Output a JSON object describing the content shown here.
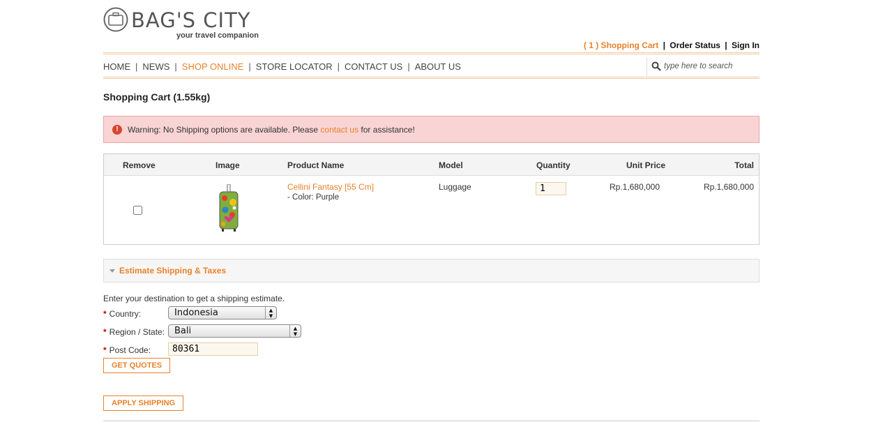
{
  "brand": {
    "name": "BAG'S CITY",
    "tagline": "your travel companion"
  },
  "toplinks": {
    "cart": "( 1 ) Shopping Cart",
    "sep1": "|",
    "order_status": "Order Status",
    "sep2": "|",
    "sign_in": "Sign In"
  },
  "nav": {
    "items": [
      {
        "label": "HOME"
      },
      {
        "label": "NEWS"
      },
      {
        "label": "SHOP ONLINE"
      },
      {
        "label": "STORE LOCATOR"
      },
      {
        "label": "CONTACT US"
      },
      {
        "label": "ABOUT US"
      }
    ],
    "separator": "|",
    "active_index": 2
  },
  "search": {
    "placeholder": "type here to search"
  },
  "page": {
    "title": "Shopping Cart  (1.55kg)"
  },
  "warning": {
    "icon": "!",
    "text_before": "Warning: No Shipping options are available. Please ",
    "link": "contact us",
    "text_after": " for assistance!"
  },
  "cart": {
    "headers": {
      "remove": "Remove",
      "image": "Image",
      "product_name": "Product Name",
      "model": "Model",
      "quantity": "Quantity",
      "unit_price": "Unit Price",
      "total": "Total"
    },
    "rows": [
      {
        "product_name": "Cellini Fantasy [55 Cm]",
        "option": "- Color: Purple",
        "model": "Luggage",
        "quantity": "1",
        "unit_price": "Rp.1,680,000",
        "total": "Rp.1,680,000"
      }
    ]
  },
  "estimate": {
    "title": "Estimate Shipping & Taxes",
    "intro": "Enter your destination to get a shipping estimate.",
    "required_mark": "*",
    "country_label": "Country:",
    "country_value": "Indonesia",
    "region_label": "Region / State:",
    "region_value": "Bali",
    "postcode_label": "Post Code:",
    "postcode_value": "80361",
    "get_quotes": "GET QUOTES",
    "apply_shipping": "APPLY SHIPPING"
  },
  "colors": {
    "accent": "#e8822a",
    "warning_bg": "#f9d4d4",
    "warning_border": "#e8a7a7"
  },
  "icons": {
    "logo": "suitcase-icon",
    "search": "magnifier-icon",
    "warning": "exclamation-circle-icon",
    "expand": "triangle-down-icon",
    "select": "updown-arrows-icon"
  }
}
